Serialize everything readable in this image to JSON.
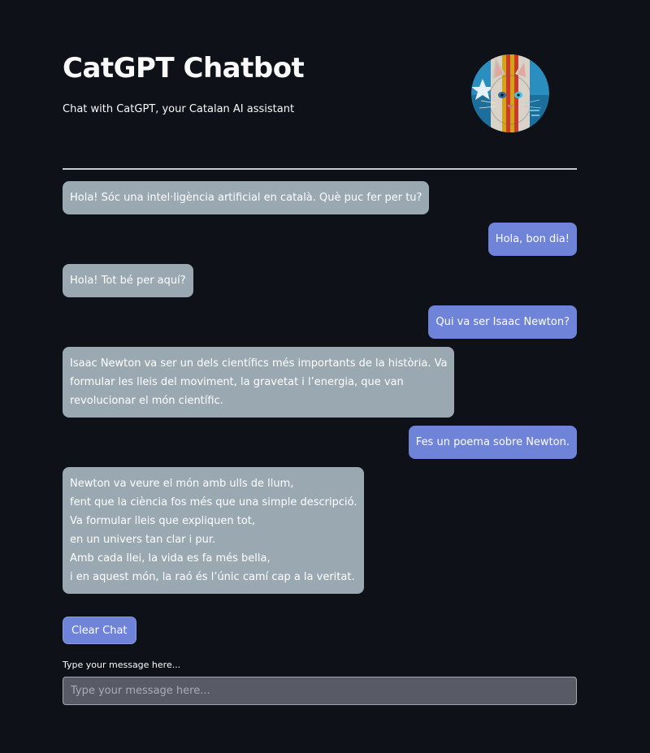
{
  "header": {
    "title": "CatGPT Chatbot",
    "subtitle": "Chat with CatGPT, your Catalan AI assistant"
  },
  "messages": [
    {
      "role": "assistant",
      "text": "Hola! Sóc una intel·ligència artificial en català. Què puc fer per tu?"
    },
    {
      "role": "user",
      "text": "Hola, bon dia!"
    },
    {
      "role": "assistant",
      "text": "Hola! Tot bé per aquí?"
    },
    {
      "role": "user",
      "text": "Qui va ser Isaac Newton?"
    },
    {
      "role": "assistant",
      "text": "Isaac Newton va ser un dels científics més importants de la història. Va\nformular les lleis del moviment, la gravetat i l’energia, que van\nrevolucionar el món científic."
    },
    {
      "role": "user",
      "text": "Fes un poema sobre Newton."
    },
    {
      "role": "assistant",
      "text": "Newton va veure el món amb ulls de llum,\nfent que la ciència fos més que una simple descripció.\nVa formular lleis que expliquen tot,\nen un univers tan clar i pur.\nAmb cada llei, la vida es fa més bella,\ni en aquest món, la raó és l’únic camí cap a la veritat."
    }
  ],
  "controls": {
    "clear_label": "Clear Chat",
    "input_label": "Type your message here...",
    "input_placeholder": "Type your message here...",
    "input_value": ""
  },
  "colors": {
    "background": "#0e1117",
    "assistant_bubble": "#9aa8b2",
    "user_bubble": "#6f84d8"
  },
  "icons": {
    "avatar": "catgpt-cat-avatar"
  }
}
